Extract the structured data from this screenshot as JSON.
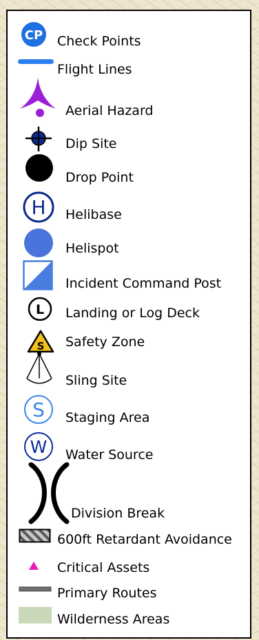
{
  "legend": {
    "items": [
      {
        "label": "Check Points",
        "icon": "check-point-icon",
        "symbol_text": "CP"
      },
      {
        "label": "Flight Lines",
        "icon": "flight-line-icon"
      },
      {
        "label": "Aerial Hazard",
        "icon": "aerial-hazard-icon"
      },
      {
        "label": "Dip Site",
        "icon": "dip-site-icon"
      },
      {
        "label": "Drop Point",
        "icon": "drop-point-icon"
      },
      {
        "label": "Helibase",
        "icon": "helibase-icon",
        "symbol_text": "H"
      },
      {
        "label": "Helispot",
        "icon": "helispot-icon"
      },
      {
        "label": "Incident Command Post",
        "icon": "incident-command-post-icon"
      },
      {
        "label": "Landing or Log Deck",
        "icon": "landing-log-deck-icon",
        "symbol_text": "L"
      },
      {
        "label": "Safety Zone",
        "icon": "safety-zone-icon",
        "symbol_text": "S"
      },
      {
        "label": "Sling Site",
        "icon": "sling-site-icon"
      },
      {
        "label": "Staging Area",
        "icon": "staging-area-icon",
        "symbol_text": "S"
      },
      {
        "label": "Water Source",
        "icon": "water-source-icon",
        "symbol_text": "W"
      },
      {
        "label": "Division Break",
        "icon": "division-break-icon"
      },
      {
        "label": "600ft Retardant Avoidance",
        "icon": "retardant-avoidance-icon"
      },
      {
        "label": "Critical Assets",
        "icon": "critical-assets-icon"
      },
      {
        "label": "Primary Routes",
        "icon": "primary-routes-icon"
      },
      {
        "label": "Wilderness Areas",
        "icon": "wilderness-areas-icon"
      }
    ]
  },
  "colors": {
    "cp_blue": "#1e6fe0",
    "flight_line": "#2f7ff0",
    "hazard_purple": "#9b1fd6",
    "helibase_navy": "#0b2a8a",
    "helispot_blue": "#4a74dc",
    "icp_blue": "#4a7de0",
    "safety_yellow": "#f2c21a",
    "staging_blue": "#3a86e8",
    "water_navy": "#0a2c9a",
    "critical_magenta": "#e81ab8",
    "route_gray": "#707070",
    "wilderness_green": "#c9d8b9"
  }
}
